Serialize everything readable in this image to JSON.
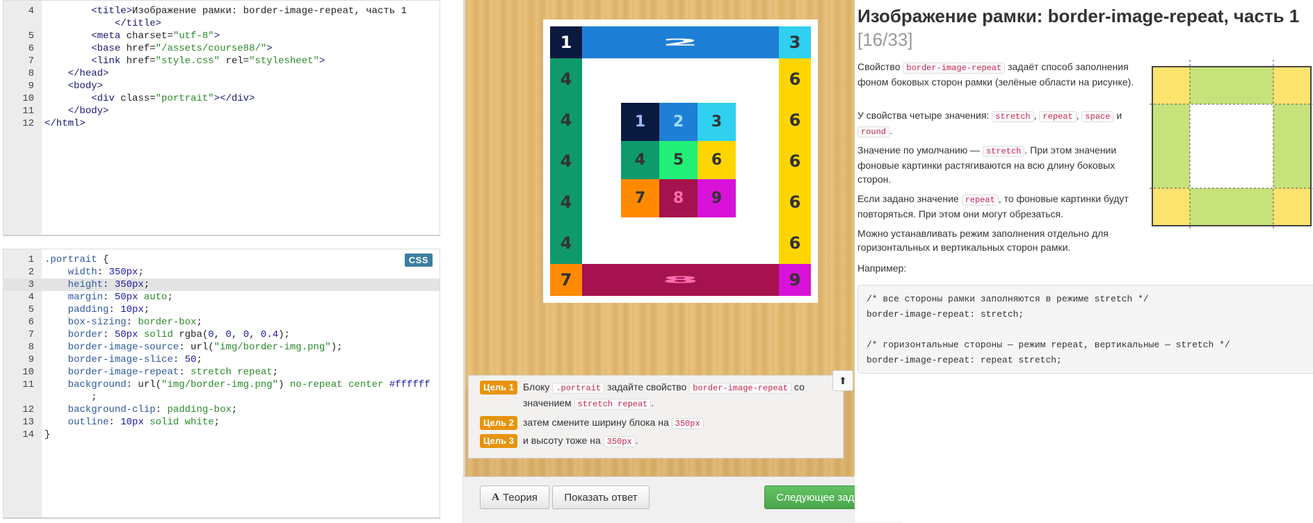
{
  "html_editor": {
    "lines": [
      {
        "num": "4",
        "segments": [
          {
            "t": "        ",
            "c": ""
          },
          {
            "t": "<title>",
            "c": "t-tag"
          },
          {
            "t": "Изображение рамки: border-image-repeat, часть 1",
            "c": ""
          }
        ]
      },
      {
        "num": "",
        "segments": [
          {
            "t": "            ",
            "c": ""
          },
          {
            "t": "</title>",
            "c": "t-tag"
          }
        ]
      },
      {
        "num": "5",
        "segments": [
          {
            "t": "        ",
            "c": ""
          },
          {
            "t": "<meta ",
            "c": "t-tag"
          },
          {
            "t": "charset=",
            "c": "t-attr"
          },
          {
            "t": "\"utf-8\"",
            "c": "t-str"
          },
          {
            "t": ">",
            "c": "t-tag"
          }
        ]
      },
      {
        "num": "6",
        "segments": [
          {
            "t": "        ",
            "c": ""
          },
          {
            "t": "<base ",
            "c": "t-tag"
          },
          {
            "t": "href=",
            "c": "t-attr"
          },
          {
            "t": "\"/assets/course88/\"",
            "c": "t-str"
          },
          {
            "t": ">",
            "c": "t-tag"
          }
        ]
      },
      {
        "num": "7",
        "segments": [
          {
            "t": "        ",
            "c": ""
          },
          {
            "t": "<link ",
            "c": "t-tag"
          },
          {
            "t": "href=",
            "c": "t-attr"
          },
          {
            "t": "\"style.css\"",
            "c": "t-str"
          },
          {
            "t": " rel=",
            "c": "t-attr"
          },
          {
            "t": "\"stylesheet\"",
            "c": "t-str"
          },
          {
            "t": ">",
            "c": "t-tag"
          }
        ]
      },
      {
        "num": "8",
        "segments": [
          {
            "t": "    ",
            "c": ""
          },
          {
            "t": "</head>",
            "c": "t-tag"
          }
        ]
      },
      {
        "num": "9",
        "segments": [
          {
            "t": "    ",
            "c": ""
          },
          {
            "t": "<body>",
            "c": "t-tag"
          }
        ]
      },
      {
        "num": "10",
        "segments": [
          {
            "t": "        ",
            "c": ""
          },
          {
            "t": "<div ",
            "c": "t-tag"
          },
          {
            "t": "class=",
            "c": "t-attr"
          },
          {
            "t": "\"portrait\"",
            "c": "t-str"
          },
          {
            "t": "></div>",
            "c": "t-tag"
          }
        ]
      },
      {
        "num": "11",
        "segments": [
          {
            "t": "    ",
            "c": ""
          },
          {
            "t": "</body>",
            "c": "t-tag"
          }
        ]
      },
      {
        "num": "12",
        "segments": [
          {
            "t": "</html>",
            "c": "t-tag"
          }
        ]
      }
    ]
  },
  "css_editor": {
    "badge": "CSS",
    "active_line": "3",
    "lines": [
      {
        "num": "1",
        "segments": [
          {
            "t": ".portrait",
            "c": "t-sel"
          },
          {
            "t": " {",
            "c": ""
          }
        ]
      },
      {
        "num": "2",
        "segments": [
          {
            "t": "    width",
            "c": "t-prop"
          },
          {
            "t": ": ",
            "c": ""
          },
          {
            "t": "350px",
            "c": "t-num"
          },
          {
            "t": ";",
            "c": ""
          }
        ]
      },
      {
        "num": "3",
        "segments": [
          {
            "t": "    height",
            "c": "t-prop"
          },
          {
            "t": ": ",
            "c": ""
          },
          {
            "t": "350px",
            "c": "t-num"
          },
          {
            "t": ";",
            "c": ""
          }
        ]
      },
      {
        "num": "4",
        "segments": [
          {
            "t": "    margin",
            "c": "t-prop"
          },
          {
            "t": ": ",
            "c": ""
          },
          {
            "t": "50px",
            "c": "t-num"
          },
          {
            "t": " auto",
            "c": "t-kw"
          },
          {
            "t": ";",
            "c": ""
          }
        ]
      },
      {
        "num": "5",
        "segments": [
          {
            "t": "    padding",
            "c": "t-prop"
          },
          {
            "t": ": ",
            "c": ""
          },
          {
            "t": "10px",
            "c": "t-num"
          },
          {
            "t": ";",
            "c": ""
          }
        ]
      },
      {
        "num": "6",
        "segments": [
          {
            "t": "    box-sizing",
            "c": "t-prop"
          },
          {
            "t": ": ",
            "c": ""
          },
          {
            "t": "border-box",
            "c": "t-kw"
          },
          {
            "t": ";",
            "c": ""
          }
        ]
      },
      {
        "num": "7",
        "segments": [
          {
            "t": "    border",
            "c": "t-prop"
          },
          {
            "t": ": ",
            "c": ""
          },
          {
            "t": "50px",
            "c": "t-num"
          },
          {
            "t": " solid ",
            "c": "t-kw"
          },
          {
            "t": "rgba(",
            "c": ""
          },
          {
            "t": "0",
            "c": "t-num"
          },
          {
            "t": ", ",
            "c": ""
          },
          {
            "t": "0",
            "c": "t-num"
          },
          {
            "t": ", ",
            "c": ""
          },
          {
            "t": "0",
            "c": "t-num"
          },
          {
            "t": ", ",
            "c": ""
          },
          {
            "t": "0.4",
            "c": "t-num"
          },
          {
            "t": ");",
            "c": ""
          }
        ]
      },
      {
        "num": "8",
        "segments": [
          {
            "t": "    border-image-source",
            "c": "t-prop"
          },
          {
            "t": ": url(",
            "c": ""
          },
          {
            "t": "\"img/border-img.png\"",
            "c": "t-str"
          },
          {
            "t": ");",
            "c": ""
          }
        ]
      },
      {
        "num": "9",
        "segments": [
          {
            "t": "    border-image-slice",
            "c": "t-prop"
          },
          {
            "t": ": ",
            "c": ""
          },
          {
            "t": "50",
            "c": "t-num"
          },
          {
            "t": ";",
            "c": ""
          }
        ]
      },
      {
        "num": "10",
        "segments": [
          {
            "t": "    border-image-repeat",
            "c": "t-prop"
          },
          {
            "t": ": ",
            "c": ""
          },
          {
            "t": "stretch repeat",
            "c": "t-kw"
          },
          {
            "t": ";",
            "c": ""
          }
        ]
      },
      {
        "num": "11",
        "segments": [
          {
            "t": "    background",
            "c": "t-prop"
          },
          {
            "t": ": url(",
            "c": ""
          },
          {
            "t": "\"img/border-img.png\"",
            "c": "t-str"
          },
          {
            "t": ") ",
            "c": ""
          },
          {
            "t": "no-repeat center ",
            "c": "t-kw"
          },
          {
            "t": "#ffffff",
            "c": "t-num"
          }
        ]
      },
      {
        "num": "",
        "segments": [
          {
            "t": "        ;",
            "c": ""
          }
        ]
      },
      {
        "num": "12",
        "segments": [
          {
            "t": "    background-clip",
            "c": "t-prop"
          },
          {
            "t": ": ",
            "c": ""
          },
          {
            "t": "padding-box",
            "c": "t-kw"
          },
          {
            "t": ";",
            "c": ""
          }
        ]
      },
      {
        "num": "13",
        "segments": [
          {
            "t": "    outline",
            "c": "t-prop"
          },
          {
            "t": ": ",
            "c": ""
          },
          {
            "t": "10px",
            "c": "t-num"
          },
          {
            "t": " solid white",
            "c": "t-kw"
          },
          {
            "t": ";",
            "c": ""
          }
        ]
      },
      {
        "num": "14",
        "segments": [
          {
            "t": "}",
            "c": ""
          }
        ]
      }
    ]
  },
  "preview": {
    "border_cells": {
      "corner_tl": {
        "label": "1",
        "color": "#0a1a3f",
        "text_color": "#ffffff"
      },
      "top": {
        "label": "2",
        "color": "#1e7fd6",
        "text_color": "#ffffff"
      },
      "corner_tr": {
        "label": "3",
        "color": "#2fd0f0",
        "text_color": "#333333"
      },
      "left": [
        "4",
        "4",
        "4",
        "4",
        "4"
      ],
      "left_color": "#0f9a6c",
      "right": [
        "6",
        "6",
        "6",
        "6",
        "6"
      ],
      "right_color": "#ffd500",
      "corner_bl": {
        "label": "7",
        "color": "#ff8a00",
        "text_color": "#333333"
      },
      "bottom": {
        "label": "8",
        "color": "#a6124d",
        "text_color": "#ff6fb0"
      },
      "corner_br": {
        "label": "9",
        "color": "#d812d8",
        "text_color": "#333333"
      }
    },
    "inner_grid": [
      {
        "label": "1",
        "color": "#0a1a3f",
        "text_color": "#9fb7ff"
      },
      {
        "label": "2",
        "color": "#1e7fd6",
        "text_color": "#9fe0ff"
      },
      {
        "label": "3",
        "color": "#2fd0f0",
        "text_color": "#333333"
      },
      {
        "label": "4",
        "color": "#0f9a6c",
        "text_color": "#333333"
      },
      {
        "label": "5",
        "color": "#22f076",
        "text_color": "#333333"
      },
      {
        "label": "6",
        "color": "#ffd500",
        "text_color": "#333333"
      },
      {
        "label": "7",
        "color": "#ff8a00",
        "text_color": "#333333"
      },
      {
        "label": "8",
        "color": "#a6124d",
        "text_color": "#ff6fb0"
      },
      {
        "label": "9",
        "color": "#d812d8",
        "text_color": "#333333"
      }
    ]
  },
  "tasks": [
    {
      "badge": "Цель 1",
      "pre": "Блоку",
      "code1": ".portrait",
      "mid": "задайте свойство",
      "code2": "border-image-repeat",
      "post": "со",
      "line2_pre": "значением",
      "code3": "stretch repeat",
      "line2_post": "."
    },
    {
      "badge": "Цель 2",
      "pre": "затем смените ширину блока на",
      "code1": "350px",
      "post": ""
    },
    {
      "badge": "Цель 3",
      "pre": "и высоту тоже на",
      "code1": "350px",
      "post": "."
    }
  ],
  "buttons": {
    "scroll_top": "⬆",
    "theory": "Теория",
    "theory_icon": "A",
    "show_answer": "Показать ответ",
    "next_task": "Следующее задание"
  },
  "theory": {
    "title": "Изображение рамки: border-image-repeat, часть 1",
    "progress": "[16/33]",
    "p1_pre": "Свойство",
    "p1_code": "border-image-repeat",
    "p1_post": "задаёт способ заполнения фоном боковых сторон рамки (зелёные области на рисунке).",
    "p2_pre": "У свойства четыре значения:",
    "p2_v1": "stretch",
    "p2_v2": "repeat",
    "p2_v3": "space",
    "p2_and": "и",
    "p2_v4": "round",
    "p3_pre": "Значение по умолчанию —",
    "p3_code": "stretch",
    "p3_post": ". При этом значении фоновые картинки растягиваются на всю длину боковых сторон.",
    "p4_pre": "Если задано значение",
    "p4_code": "repeat",
    "p4_post": ", то фоновые картинки будут повторяться. При этом они могут обрезаться.",
    "p5": "Можно устанавливать режим заполнения отдельно для горизонтальных и вертикальных сторон рамки.",
    "p6": "Например:",
    "example": [
      "/* все стороны рамки заполняются в режиме stretch */",
      "border-image-repeat: stretch;",
      "",
      "/* горизонтальные стороны — режим repeat, вертикальные — stretch */",
      "border-image-repeat: repeat stretch;"
    ],
    "diagram_colors": {
      "corner": "#fce36e",
      "side": "#c6e27a",
      "center": "#ffffff",
      "border": "#444444"
    }
  }
}
